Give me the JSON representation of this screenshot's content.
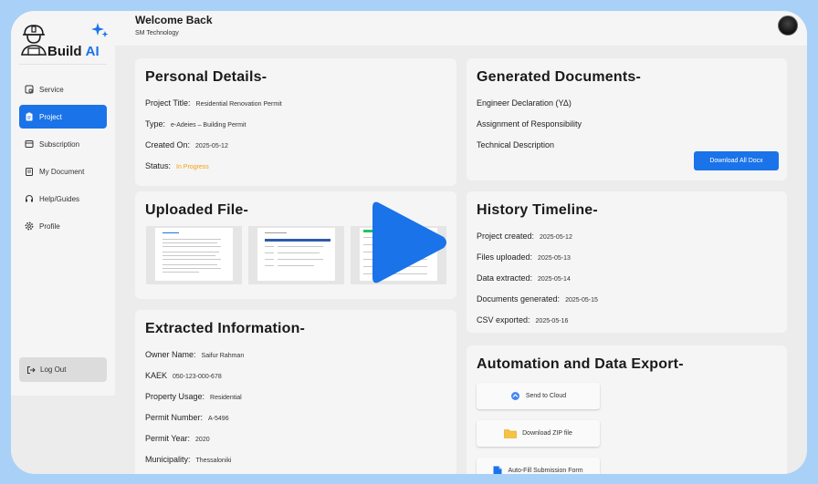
{
  "brand": {
    "name_prefix": "Build",
    "name_suffix": "AI"
  },
  "sidebar": {
    "items": [
      {
        "label": "Service",
        "icon": "service-icon"
      },
      {
        "label": "Project",
        "icon": "clipboard-icon",
        "active": true
      },
      {
        "label": "Subscription",
        "icon": "subscription-icon"
      },
      {
        "label": "My Document",
        "icon": "document-icon"
      },
      {
        "label": "Help/Guides",
        "icon": "headset-icon"
      },
      {
        "label": "Profile",
        "icon": "gear-icon"
      }
    ],
    "logout_label": "Log Out"
  },
  "header": {
    "title": "Welcome Back",
    "subtitle": "SM Technology"
  },
  "personal": {
    "title": "Personal Details-",
    "project_title_label": "Project Title:",
    "project_title": "Residential Renovation Permit",
    "type_label": "Type:",
    "type": "e-Adeies – Building Permit",
    "created_label": "Created On:",
    "created": "2025-05-12",
    "status_label": "Status:",
    "status": "In Progress"
  },
  "generated": {
    "title": "Generated Documents-",
    "docs": [
      "Engineer Declaration (ΥΔ)",
      "Assignment of Responsibility",
      "Technical Description"
    ],
    "download_label": "Download All Docx"
  },
  "uploaded": {
    "title": "Uploaded File-"
  },
  "history": {
    "title": "History Timeline-",
    "events": [
      {
        "label": "Project created:",
        "date": "2025-05-12"
      },
      {
        "label": "Files uploaded:",
        "date": "2025-05-13"
      },
      {
        "label": "Data extracted:",
        "date": "2025-05-14"
      },
      {
        "label": "Documents generated:",
        "date": "2025-05-15"
      },
      {
        "label": "CSV exported:",
        "date": "2025-05-16"
      }
    ]
  },
  "extracted": {
    "title": "Extracted Information-",
    "fields": [
      {
        "label": "Owner Name:",
        "value": "Saifur Rahman"
      },
      {
        "label": "KAEK",
        "value": "050-123-000-678"
      },
      {
        "label": "Property Usage:",
        "value": "Residential"
      },
      {
        "label": "Permit Number:",
        "value": "A-5496"
      },
      {
        "label": "Permit Year:",
        "value": "2020"
      },
      {
        "label": "Municipality:",
        "value": "Thessaloniki"
      }
    ]
  },
  "automation": {
    "title": "Automation and Data Export-",
    "buttons": [
      {
        "label": "Send to Cloud",
        "icon": "cloud-icon"
      },
      {
        "label": "Download ZIP file",
        "icon": "folder-icon"
      },
      {
        "label": "Auto-Fill Submission Form",
        "icon": "form-icon"
      }
    ]
  },
  "colors": {
    "accent": "#1a73e8",
    "status_in_progress": "#f59e0b",
    "background": "#a9d0f7"
  }
}
